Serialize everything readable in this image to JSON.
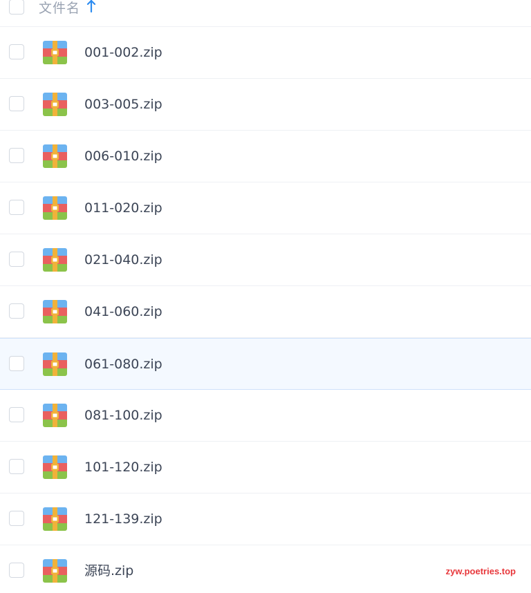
{
  "header": {
    "name_label": "文件名",
    "sort_icon": "arrow-up-icon",
    "sort_direction": "ascending"
  },
  "files": [
    {
      "name": "001-002.zip",
      "icon": "zip-archive-icon"
    },
    {
      "name": "003-005.zip",
      "icon": "zip-archive-icon"
    },
    {
      "name": "006-010.zip",
      "icon": "zip-archive-icon"
    },
    {
      "name": "011-020.zip",
      "icon": "zip-archive-icon"
    },
    {
      "name": "021-040.zip",
      "icon": "zip-archive-icon"
    },
    {
      "name": "041-060.zip",
      "icon": "zip-archive-icon"
    },
    {
      "name": "061-080.zip",
      "icon": "zip-archive-icon",
      "hovered": true
    },
    {
      "name": "081-100.zip",
      "icon": "zip-archive-icon"
    },
    {
      "name": "101-120.zip",
      "icon": "zip-archive-icon"
    },
    {
      "name": "121-139.zip",
      "icon": "zip-archive-icon"
    },
    {
      "name": "源码.zip",
      "icon": "zip-archive-icon"
    }
  ],
  "watermark": "zyw.poetries.top",
  "colors": {
    "accent": "#2d8cf0",
    "hover_row": "#f4f9ff",
    "text": "#3c4556",
    "header_text": "#9aa3b2",
    "watermark": "#e8383c"
  }
}
